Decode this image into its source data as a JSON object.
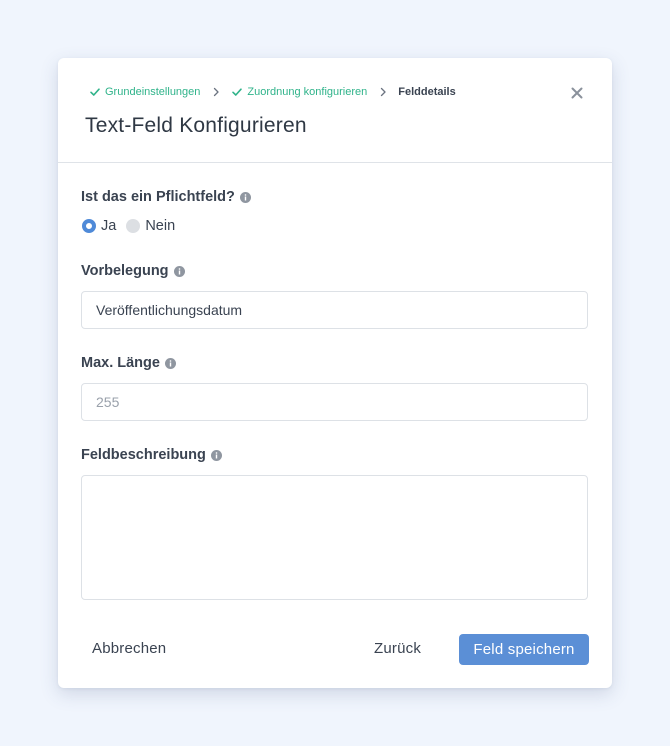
{
  "breadcrumb": {
    "steps": [
      {
        "label": "Grundeinstellungen",
        "state": "done"
      },
      {
        "label": "Zuordnung konfigurieren",
        "state": "done"
      },
      {
        "label": "Felddetails",
        "state": "current"
      }
    ],
    "done_color": "#2fb38a",
    "done_icon": "check-icon",
    "separator_icon": "chevron-right-icon"
  },
  "dialog": {
    "title": "Text-Feld Konfigurieren",
    "close_icon": "close-icon"
  },
  "form": {
    "required": {
      "label": "Ist das ein Pflichtfeld?",
      "options": [
        {
          "label": "Ja",
          "selected": true
        },
        {
          "label": "Nein",
          "selected": false
        }
      ]
    },
    "default_value": {
      "label": "Vorbelegung",
      "value": "Veröffentlichungsdatum"
    },
    "max_length": {
      "label": "Max. Länge",
      "placeholder": "255",
      "value": ""
    },
    "description": {
      "label": "Feldbeschreibung",
      "value": ""
    }
  },
  "footer": {
    "cancel_label": "Abbrechen",
    "back_label": "Zurück",
    "save_label": "Feld speichern"
  },
  "colors": {
    "accent": "#5b8fd6",
    "radio_selected": "#4f8ad8",
    "background": "#f0f5fd"
  }
}
